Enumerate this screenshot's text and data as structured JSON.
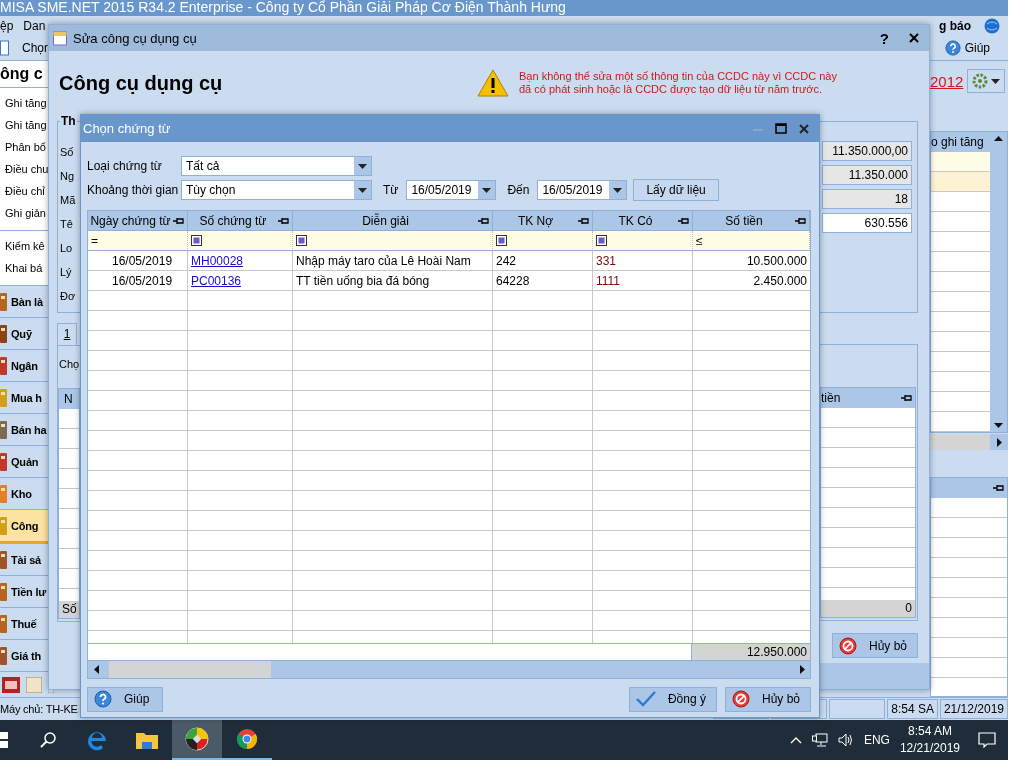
{
  "main_window": {
    "title": "MISA SME.NET 2015 R34.2 Enterprise - Công ty Cổ Phần Giải Pháp Cơ Điện Thành Hưng",
    "menu": [
      "ệp",
      "Dan"
    ],
    "notify": "g báo",
    "toolbar_item": "Chọn",
    "help": "Giúp",
    "year_link": "2012",
    "sidebar": {
      "title": "ông c",
      "tasks": [
        "Ghi tăng",
        "Ghi tăng",
        "Phân bổ",
        "Điều chu",
        "Điều chỉ",
        "Ghi giản"
      ],
      "tasks_2": [
        "Kiểm kê",
        "Khai bá"
      ],
      "modules": [
        {
          "label": "Bàn là",
          "selected": false
        },
        {
          "label": "Quỹ",
          "selected": false
        },
        {
          "label": "Ngân",
          "selected": false
        },
        {
          "label": "Mua h",
          "selected": false
        },
        {
          "label": "Bán ha",
          "selected": false
        },
        {
          "label": "Quản",
          "selected": false
        },
        {
          "label": "Kho",
          "selected": false
        },
        {
          "label": "Công",
          "selected": true
        },
        {
          "label": "Tài sả",
          "selected": false
        },
        {
          "label": "Tiền lư",
          "selected": false
        },
        {
          "label": "Thuế",
          "selected": false
        },
        {
          "label": "Giá th",
          "selected": false
        }
      ]
    },
    "right_grid": {
      "column": "o ghi tăng"
    },
    "status_bar": {
      "server": "Máy chủ: TH-KE",
      "time": "8:54 SA",
      "date": "21/12/2019"
    }
  },
  "edit_dialog": {
    "title": "Sửa công cụ dụng cụ",
    "help": "?",
    "heading": "Công cụ dụng cụ",
    "warning": [
      "Bạn không thể sửa một số thông tin của CCDC này vì CCDC này",
      "đã có phát sinh hoặc là CCDC được tạo dữ liệu từ năm trước."
    ],
    "group_title": "Th",
    "field_labels": [
      "Số",
      "Ng",
      "Mã",
      "Tê",
      "Lo",
      "Lý",
      "Đơ"
    ],
    "field_values": [
      {
        "text": "11.350.000,00",
        "disabled": true
      },
      {
        "text": "11.350.000",
        "disabled": true
      },
      {
        "text": "18",
        "disabled": true
      },
      {
        "text": "630.556",
        "disabled": false
      }
    ],
    "tab": "1",
    "section_label": "Chọ",
    "grid_columns": [
      "N",
      "tiền"
    ],
    "footer_label": "Số",
    "footer_total": "0",
    "cancel": "Hủy bỏ"
  },
  "dialog": {
    "title": "Chọn chứng từ",
    "doc_type": {
      "label": "Loại chứng từ",
      "value": "Tất cả"
    },
    "period": {
      "label": "Khoảng thời gian",
      "value": "Tùy chọn"
    },
    "from": {
      "label": "Từ",
      "value": "16/05/2019"
    },
    "to": {
      "label": "Đến",
      "value": "16/05/2019"
    },
    "fetch_button": "Lấy dữ liệu",
    "table": {
      "columns": [
        "Ngày chứng từ",
        "Số chứng từ",
        "Diễn giải",
        "TK Nợ",
        "TK Có",
        "Số tiền"
      ],
      "filter_row": [
        {
          "kind": "operator",
          "text": "="
        },
        {
          "kind": "icon"
        },
        {
          "kind": "icon"
        },
        {
          "kind": "icon"
        },
        {
          "kind": "icon"
        },
        {
          "kind": "operator",
          "text": "≤"
        }
      ],
      "rows": [
        {
          "date": "16/05/2019",
          "number": "MH00028",
          "description": "Nhập máy taro của Lê Hoài Nam",
          "debit": "242",
          "credit": "331",
          "amount": "10.500.000"
        },
        {
          "date": "16/05/2019",
          "number": "PC00136",
          "description": "TT tiền uống bia đá bóng",
          "debit": "64228",
          "credit": "1111",
          "amount": "2.450.000"
        }
      ],
      "total": "12.950.000"
    },
    "help_button": "Giúp",
    "ok_button": "Đồng ý",
    "cancel_button": "Hủy bỏ"
  },
  "taskbar": {
    "language": "ENG",
    "time": "8:54 AM",
    "date": "12/21/2019"
  }
}
